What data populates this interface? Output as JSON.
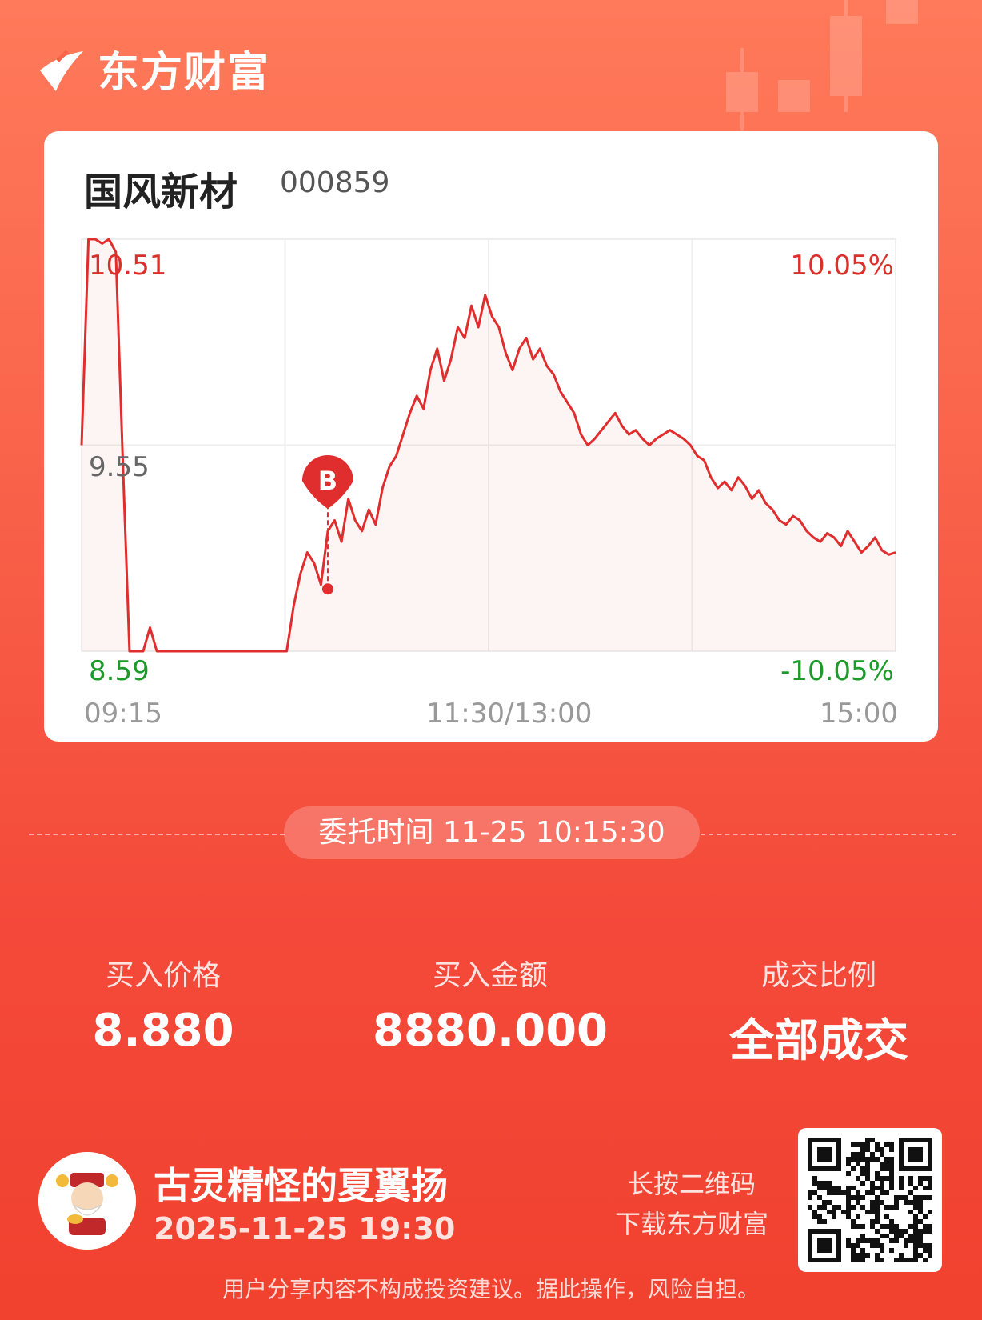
{
  "brand": {
    "name": "东方财富"
  },
  "stock": {
    "name": "国风新材",
    "code": "000859"
  },
  "chart_data": {
    "type": "line",
    "y_labels": {
      "high": "10.51",
      "mid": "9.55",
      "low": "8.59",
      "high_pct": "10.05%",
      "low_pct": "-10.05%"
    },
    "x_labels": [
      "09:15",
      "11:30/13:00",
      "15:00"
    ],
    "ylim": [
      8.59,
      10.51
    ],
    "series": [
      {
        "values": [
          9.55,
          10.51,
          10.51,
          10.49,
          10.51,
          10.45,
          9.5,
          8.59,
          8.59,
          8.59,
          8.7,
          8.59,
          8.59,
          8.59,
          8.59,
          8.59,
          8.59,
          8.59,
          8.59,
          8.59,
          8.59,
          8.59,
          8.59,
          8.59,
          8.59,
          8.59,
          8.59,
          8.59,
          8.59,
          8.59,
          8.59,
          8.8,
          8.95,
          9.05,
          9.0,
          8.9,
          9.15,
          9.2,
          9.1,
          9.3,
          9.2,
          9.15,
          9.25,
          9.18,
          9.35,
          9.45,
          9.5,
          9.6,
          9.7,
          9.78,
          9.72,
          9.9,
          10.0,
          9.85,
          9.95,
          10.1,
          10.05,
          10.2,
          10.1,
          10.25,
          10.15,
          10.1,
          9.98,
          9.9,
          10.0,
          10.05,
          9.95,
          10.0,
          9.92,
          9.88,
          9.8,
          9.75,
          9.7,
          9.6,
          9.55,
          9.58,
          9.62,
          9.66,
          9.7,
          9.64,
          9.6,
          9.62,
          9.58,
          9.55,
          9.58,
          9.6,
          9.62,
          9.6,
          9.58,
          9.55,
          9.5,
          9.48,
          9.4,
          9.35,
          9.38,
          9.34,
          9.4,
          9.36,
          9.3,
          9.34,
          9.28,
          9.25,
          9.2,
          9.18,
          9.22,
          9.2,
          9.15,
          9.12,
          9.1,
          9.14,
          9.12,
          9.08,
          9.15,
          9.1,
          9.05,
          9.08,
          9.12,
          9.06,
          9.04,
          9.05
        ]
      }
    ]
  },
  "trade": {
    "order_time_label": "委托时间",
    "order_time": "11-25 10:15:30",
    "marker": "B",
    "marker_price": 8.88,
    "buy_price_label": "买入价格",
    "buy_price": "8.880",
    "buy_amount_label": "买入金额",
    "buy_amount": "8880.000",
    "fill_ratio_label": "成交比例",
    "fill_ratio": "全部成交"
  },
  "user": {
    "name": "古灵精怪的夏翼扬",
    "share_time": "2025-11-25 19:30"
  },
  "qr": {
    "hint_line1": "长按二维码",
    "hint_line2": "下载东方财富"
  },
  "disclaimer": "用户分享内容不构成投资建议。据此操作，风险自担。",
  "colors": {
    "up": "#d9302c",
    "down": "#1e9a2a",
    "line": "#e02d2d",
    "bg": "#f4493a"
  }
}
